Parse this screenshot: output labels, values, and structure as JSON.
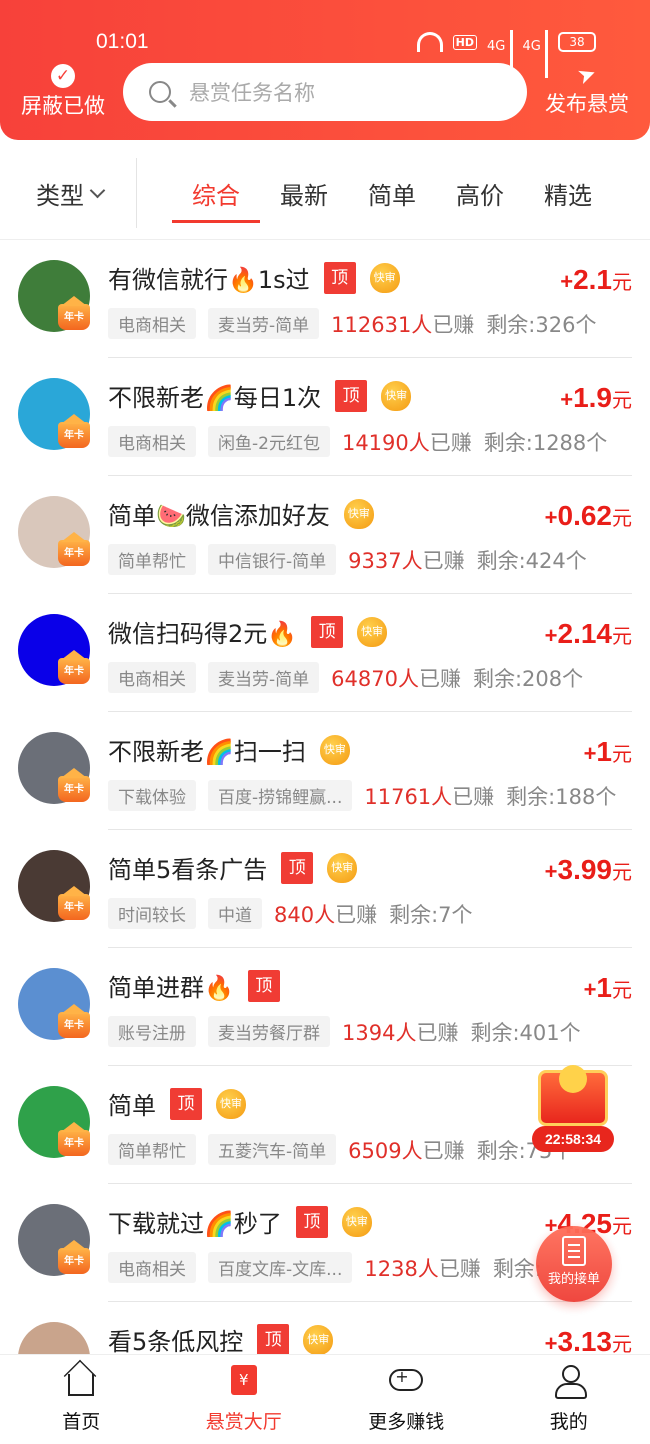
{
  "status_bar": {
    "time": "01:01",
    "hd": "HD",
    "net1": "4G",
    "net2": "4G",
    "battery": "38"
  },
  "header": {
    "left_label": "屏蔽已做",
    "search_placeholder": "悬赏任务名称",
    "right_label": "发布悬赏",
    "accent": "#f7413a"
  },
  "filter": {
    "type_label": "类型",
    "tabs": [
      "综合",
      "最新",
      "简单",
      "高价",
      "精选"
    ],
    "active_tab": 0
  },
  "tasks": [
    {
      "title": "有微信就行🔥1s过",
      "top": true,
      "fast": true,
      "tag1": "电商相关",
      "tag2": "麦当劳-简单",
      "earned": "112631人",
      "earned_suffix": "已赚",
      "remain": "剩余:326个",
      "price": "2.1",
      "avatar_color": "#3f7d3a",
      "year_card": "年卡"
    },
    {
      "title": "不限新老🌈每日1次",
      "top": true,
      "fast": true,
      "tag1": "电商相关",
      "tag2": "闲鱼-2元红包",
      "earned": "14190人",
      "earned_suffix": "已赚",
      "remain": "剩余:1288个",
      "price": "1.9",
      "avatar_color": "#2aa7d8",
      "year_card": "年卡"
    },
    {
      "title": "简单🍉微信添加好友",
      "top": false,
      "fast": true,
      "tag1": "简单帮忙",
      "tag2": "中信银行-简单",
      "earned": "9337人",
      "earned_suffix": "已赚",
      "remain": "剩余:424个",
      "price": "0.62",
      "avatar_color": "#d9c7bb",
      "year_card": "年卡"
    },
    {
      "title": "微信扫码得2元🔥",
      "top": true,
      "fast": true,
      "tag1": "电商相关",
      "tag2": "麦当劳-简单",
      "earned": "64870人",
      "earned_suffix": "已赚",
      "remain": "剩余:208个",
      "price": "2.14",
      "avatar_color": "#0a00e8",
      "year_card": "年卡"
    },
    {
      "title": "不限新老🌈扫一扫",
      "top": false,
      "fast": true,
      "tag1": "下载体验",
      "tag2": "百度-捞锦鲤赢...",
      "earned": "11761人",
      "earned_suffix": "已赚",
      "remain": "剩余:188个",
      "price": "1",
      "avatar_color": "#6b6f78",
      "year_card": "年卡"
    },
    {
      "title": "简单5看条广告",
      "top": true,
      "fast": true,
      "tag1": "时间较长",
      "tag2": "中道",
      "earned": "840人",
      "earned_suffix": "已赚",
      "remain": "剩余:7个",
      "price": "3.99",
      "avatar_color": "#4a3a34",
      "year_card": "年卡"
    },
    {
      "title": "简单进群🔥",
      "top": true,
      "fast": false,
      "tag1": "账号注册",
      "tag2": "麦当劳餐厅群",
      "earned": "1394人",
      "earned_suffix": "已赚",
      "remain": "剩余:401个",
      "price": "1",
      "avatar_color": "#5b8fd1",
      "year_card": "年卡"
    },
    {
      "title": "简单",
      "top": true,
      "fast": true,
      "tag1": "简单帮忙",
      "tag2": "五菱汽车-简单",
      "earned": "6509人",
      "earned_suffix": "已赚",
      "remain": "剩余:75个",
      "price": "",
      "avatar_color": "#2fa14a",
      "year_card": "年卡"
    },
    {
      "title": "下载就过🌈秒了",
      "top": true,
      "fast": true,
      "tag1": "电商相关",
      "tag2": "百度文库-文库...",
      "earned": "1238人",
      "earned_suffix": "已赚",
      "remain": "剩余:",
      "price": "4.25",
      "avatar_color": "#6b6f78",
      "year_card": "年卡"
    },
    {
      "title": "看5条低风控",
      "top": true,
      "fast": true,
      "tag1": "",
      "tag2": "",
      "earned": "",
      "earned_suffix": "",
      "remain": "",
      "price": "3.13",
      "avatar_color": "#c9a48c",
      "year_card": ""
    }
  ],
  "price_unit": "元",
  "price_plus": "+",
  "badge_top_label": "顶",
  "badge_fast_label": "快审",
  "floating": {
    "timer": "22:58:34",
    "orders_label": "我的接单"
  },
  "tabbar": [
    {
      "label": "首页",
      "icon": "home-icon"
    },
    {
      "label": "悬赏大厅",
      "icon": "hall-icon",
      "active": true
    },
    {
      "label": "更多赚钱",
      "icon": "gamepad-icon"
    },
    {
      "label": "我的",
      "icon": "user-icon"
    }
  ]
}
